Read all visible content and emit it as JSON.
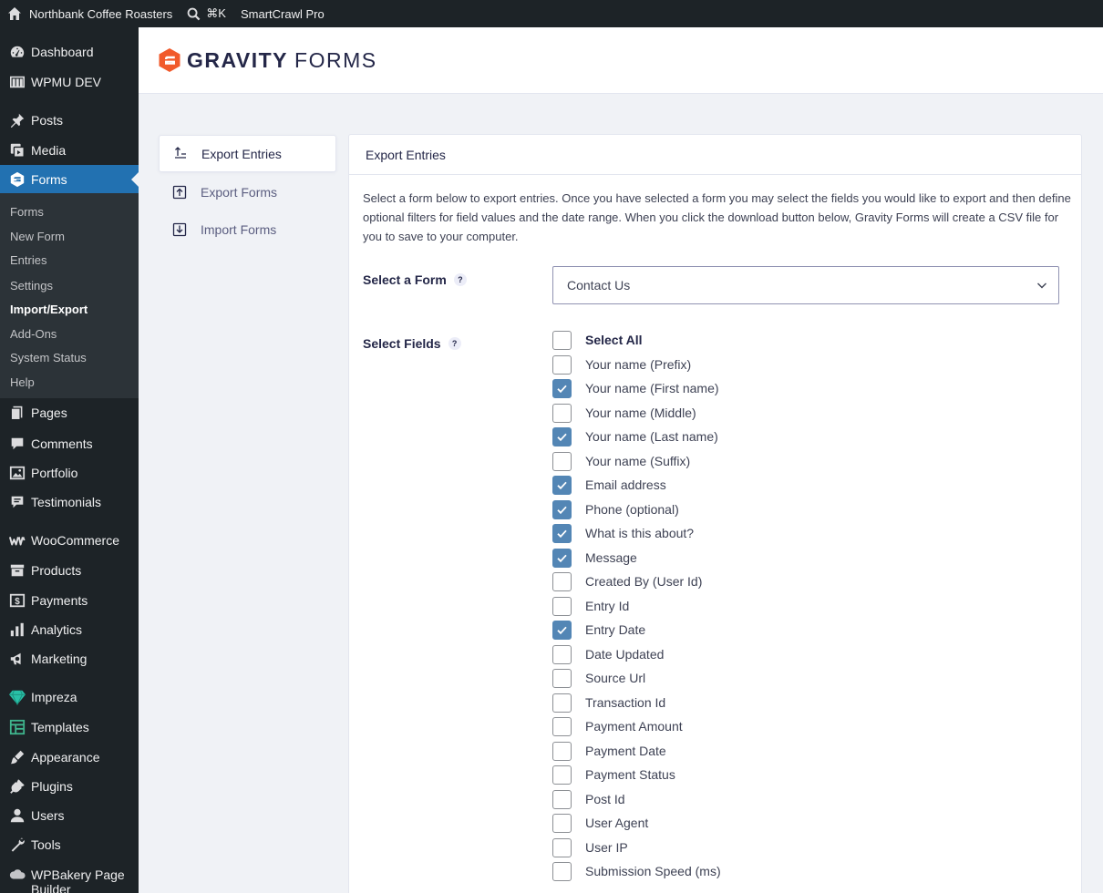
{
  "admin_bar": {
    "site_name": "Northbank Coffee Roasters",
    "search_shortcut": "⌘K",
    "plugin": "SmartCrawl Pro"
  },
  "sidebar": {
    "top_items": [
      {
        "label": "Dashboard",
        "icon": "dashboard-icon"
      },
      {
        "label": "WPMU DEV",
        "icon": "wpmudev-icon"
      },
      {
        "label": "Posts",
        "icon": "pin-icon"
      },
      {
        "label": "Media",
        "icon": "media-icon"
      },
      {
        "label": "Forms",
        "icon": "gravity-forms-icon"
      }
    ],
    "forms_submenu": [
      "Forms",
      "New Form",
      "Entries",
      "Settings",
      "Import/Export",
      "Add-Ons",
      "System Status",
      "Help"
    ],
    "bottom_items": [
      {
        "label": "Pages",
        "icon": "pages-icon"
      },
      {
        "label": "Comments",
        "icon": "comments-icon"
      },
      {
        "label": "Portfolio",
        "icon": "portfolio-icon"
      },
      {
        "label": "Testimonials",
        "icon": "testimonials-icon"
      },
      {
        "label": "WooCommerce",
        "icon": "woocommerce-icon"
      },
      {
        "label": "Products",
        "icon": "products-icon"
      },
      {
        "label": "Payments",
        "icon": "payments-icon"
      },
      {
        "label": "Analytics",
        "icon": "analytics-icon"
      },
      {
        "label": "Marketing",
        "icon": "marketing-icon"
      },
      {
        "label": "Impreza",
        "icon": "impreza-icon"
      },
      {
        "label": "Templates",
        "icon": "templates-icon"
      },
      {
        "label": "Appearance",
        "icon": "appearance-icon"
      },
      {
        "label": "Plugins",
        "icon": "plugins-icon"
      },
      {
        "label": "Users",
        "icon": "users-icon"
      },
      {
        "label": "Tools",
        "icon": "tools-icon"
      },
      {
        "label": "WPBakery Page Builder",
        "icon": "wpbakery-icon"
      }
    ]
  },
  "header": {
    "logo_word1": "GRAVITY",
    "logo_word2": "FORMS"
  },
  "subnav": [
    {
      "label": "Export Entries",
      "icon": "export-entries-icon"
    },
    {
      "label": "Export Forms",
      "icon": "export-forms-icon"
    },
    {
      "label": "Import Forms",
      "icon": "import-forms-icon"
    }
  ],
  "panel": {
    "title": "Export Entries",
    "description": "Select a form below to export entries. Once you have selected a form you may select the fields you would like to export and then define optional filters for field values and the date range. When you click the download button below, Gravity Forms will create a CSV file for you to save to your computer.",
    "select_form_label": "Select a Form",
    "select_form_value": "Contact Us",
    "select_fields_label": "Select Fields",
    "help": "?",
    "fields": [
      {
        "label": "Select All",
        "checked": false
      },
      {
        "label": "Your name (Prefix)",
        "checked": false
      },
      {
        "label": "Your name (First name)",
        "checked": true
      },
      {
        "label": "Your name (Middle)",
        "checked": false
      },
      {
        "label": "Your name (Last name)",
        "checked": true
      },
      {
        "label": "Your name (Suffix)",
        "checked": false
      },
      {
        "label": "Email address",
        "checked": true
      },
      {
        "label": "Phone (optional)",
        "checked": true
      },
      {
        "label": "What is this about?",
        "checked": true
      },
      {
        "label": "Message",
        "checked": true
      },
      {
        "label": "Created By (User Id)",
        "checked": false
      },
      {
        "label": "Entry Id",
        "checked": false
      },
      {
        "label": "Entry Date",
        "checked": true
      },
      {
        "label": "Date Updated",
        "checked": false
      },
      {
        "label": "Source Url",
        "checked": false
      },
      {
        "label": "Transaction Id",
        "checked": false
      },
      {
        "label": "Payment Amount",
        "checked": false
      },
      {
        "label": "Payment Date",
        "checked": false
      },
      {
        "label": "Payment Status",
        "checked": false
      },
      {
        "label": "Post Id",
        "checked": false
      },
      {
        "label": "User Agent",
        "checked": false
      },
      {
        "label": "User IP",
        "checked": false
      },
      {
        "label": "Submission Speed (ms)",
        "checked": false
      }
    ]
  },
  "colors": {
    "admin_dark": "#1d2327",
    "active_menu": "#2271b1",
    "checkbox_checked": "#5386b5",
    "gf_orange": "#f15a2b"
  }
}
